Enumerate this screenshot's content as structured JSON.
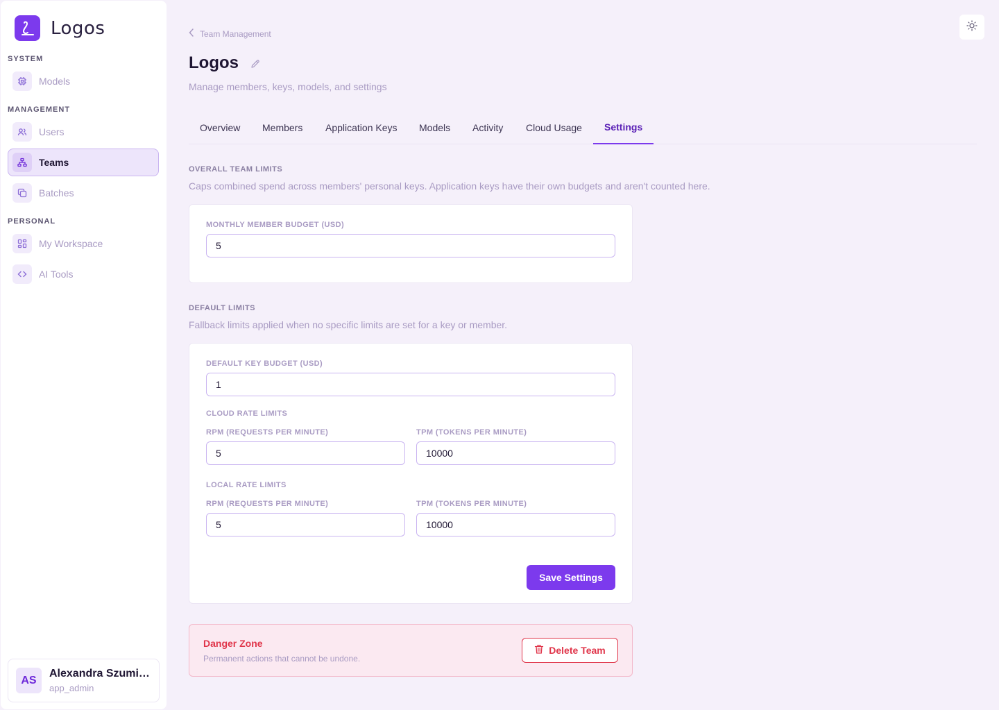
{
  "app": {
    "name": "Logos"
  },
  "sidebar": {
    "sections": [
      {
        "label": "SYSTEM"
      },
      {
        "label": "MANAGEMENT"
      },
      {
        "label": "PERSONAL"
      }
    ],
    "items": [
      {
        "label": "Models",
        "icon": "cpu-icon"
      },
      {
        "label": "Users",
        "icon": "users-icon"
      },
      {
        "label": "Teams",
        "icon": "network-icon",
        "active": true
      },
      {
        "label": "Batches",
        "icon": "copy-icon"
      },
      {
        "label": "My Workspace",
        "icon": "grid-icon"
      },
      {
        "label": "AI Tools",
        "icon": "code-icon"
      }
    ],
    "user": {
      "initials": "AS",
      "name": "Alexandra Szumi…",
      "role": "app_admin"
    }
  },
  "header": {
    "breadcrumb": "Team Management",
    "title": "Logos",
    "subtitle": "Manage members, keys, models, and settings"
  },
  "tabs": [
    {
      "label": "Overview"
    },
    {
      "label": "Members"
    },
    {
      "label": "Application Keys"
    },
    {
      "label": "Models"
    },
    {
      "label": "Activity"
    },
    {
      "label": "Cloud Usage"
    },
    {
      "label": "Settings",
      "active": true
    }
  ],
  "overall": {
    "label": "OVERALL TEAM LIMITS",
    "desc": "Caps combined spend across members' personal keys. Application keys have their own budgets and aren't counted here.",
    "budget_label": "MONTHLY MEMBER BUDGET (USD)",
    "budget_value": "5"
  },
  "defaults": {
    "label": "DEFAULT LIMITS",
    "desc": "Fallback limits applied when no specific limits are set for a key or member.",
    "key_budget_label": "DEFAULT KEY BUDGET (USD)",
    "key_budget_value": "1",
    "cloud_label": "CLOUD RATE LIMITS",
    "cloud_rpm_label": "RPM (REQUESTS PER MINUTE)",
    "cloud_rpm_value": "5",
    "cloud_tpm_label": "TPM (TOKENS PER MINUTE)",
    "cloud_tpm_value": "10000",
    "local_label": "LOCAL RATE LIMITS",
    "local_rpm_label": "RPM (REQUESTS PER MINUTE)",
    "local_rpm_value": "5",
    "local_tpm_label": "TPM (TOKENS PER MINUTE)",
    "local_tpm_value": "10000",
    "save_label": "Save Settings"
  },
  "danger": {
    "title": "Danger Zone",
    "desc": "Permanent actions that cannot be undone.",
    "delete_label": "Delete Team"
  },
  "colors": {
    "accent": "#7c3aed",
    "danger": "#e0354a",
    "background": "#f5f0fa"
  }
}
